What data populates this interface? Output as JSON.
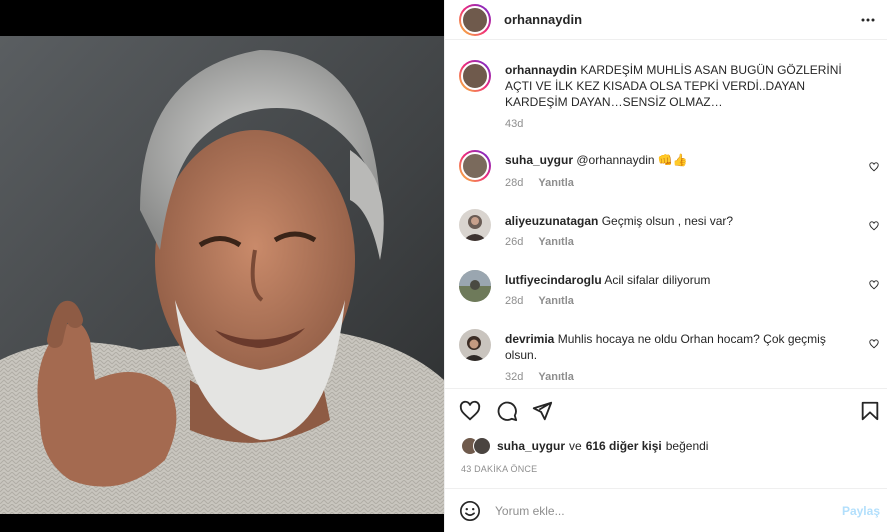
{
  "post": {
    "author": "orhannaydin",
    "caption_user": "orhannaydin",
    "caption_line1": "KARDEŞİM MUHLİS ASAN BUGÜN GÖZLERİNİ",
    "caption_line2": "AÇTI VE İLK KEZ KISADA OLSA TEPKİ VERDİ..DAYAN",
    "caption_line3": "KARDEŞİM DAYAN…SENSİZ OLMAZ…",
    "caption_age": "43d"
  },
  "comments": [
    {
      "user": "suha_uygur",
      "text": "@orhannaydin 👊👍",
      "age": "28d",
      "reply": "Yanıtla"
    },
    {
      "user": "aliyeuzunatagan",
      "text": "Geçmiş olsun , nesi var?",
      "age": "26d",
      "reply": "Yanıtla"
    },
    {
      "user": "lutfiyecindaroglu",
      "text": "Acil sifalar diliyorum",
      "age": "28d",
      "reply": "Yanıtla"
    },
    {
      "user": "devrimia",
      "text_line1": "Muhlis hocaya ne oldu Orhan hocam? Çok geçmiş",
      "text_line2": "olsun.",
      "age": "32d",
      "reply": "Yanıtla"
    }
  ],
  "likes": {
    "user": "suha_uygur",
    "conj": "ve",
    "others": "616 diğer kişi",
    "verb": "beğendi"
  },
  "timestamp": "43 DAKİKA ÖNCE",
  "add_comment": {
    "placeholder": "Yorum ekle...",
    "submit_label": "Paylaş"
  },
  "colors": {
    "text": "#262626",
    "muted": "#8e8e8e",
    "divider": "#efefef",
    "share_disabled": "#b2dffc"
  },
  "icons": [
    "more-icon",
    "heart-icon",
    "comment-icon",
    "share-icon",
    "bookmark-icon",
    "emoji-icon"
  ]
}
